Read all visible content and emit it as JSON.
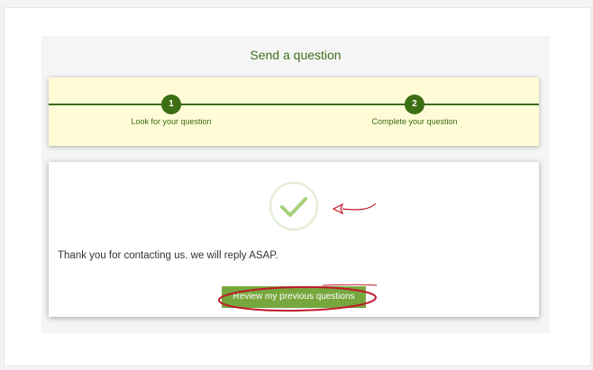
{
  "page": {
    "title": "Send a question"
  },
  "steps": [
    {
      "number": "1",
      "label": "Look for your question"
    },
    {
      "number": "2",
      "label": "Complete your question"
    }
  ],
  "confirmation": {
    "icon": "check-icon",
    "message": "Thank you for contacting us. we will reply ASAP.",
    "review_button_label": "Review my previous questions"
  },
  "colors": {
    "accent": "#3c6e14",
    "button": "#76a73d",
    "stepper_bg": "#fffbd6",
    "annotation": "#c0182a"
  }
}
